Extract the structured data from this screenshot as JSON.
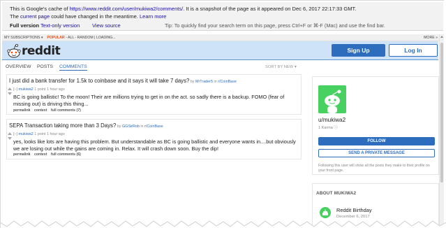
{
  "cache_banner": {
    "line1_prefix": "This is Google's cache of ",
    "line1_url": "https://www.reddit.com/user/mukiwa2/comments/",
    "line1_suffix": ". It is a snapshot of the page as it appeared on Dec 6, 2017 22:17:33 GMT.",
    "line2_prefix": "The ",
    "line2_link": "current page",
    "line2_suffix": " could have changed in the meantime. ",
    "learn_more": "Learn more",
    "full_version": "Full version",
    "text_only": "Text-only version",
    "view_source": "View source",
    "tip": "Tip: To quickly find your search term on this page, press Ctrl+F or ⌘-F (Mac) and use the find bar."
  },
  "subreddit_bar": {
    "my_subscriptions": "MY SUBSCRIPTIONS ▾",
    "popular": "POPULAR",
    "rest": " - ALL - RANDOM  |  LOADING...",
    "more": "MORE »"
  },
  "header": {
    "wordmark": "reddit",
    "signup": "Sign Up",
    "login": "Log In"
  },
  "tabs": {
    "overview": "OVERVIEW",
    "posts": "POSTS",
    "comments": "COMMENTS",
    "sort": "SORT BY NEW ▾"
  },
  "comments": [
    {
      "post_title": "I just did a bank transfer for 1.5k to coinbase and it says it will take 7 days?",
      "by_prefix": " by ",
      "post_author": "MrTrader5",
      "in_prefix": " in ",
      "subreddit": "r/CoinBase",
      "collapse": "[–] ",
      "user": "mukiwa2",
      "meta": " 1 point 1 hour ago",
      "body": "BC is going ballistic! To the moon! Their are millions trying to get in on the act. so sadly there is a backup. FOMO (fear of missing out) is driving this thing...",
      "permalink": "permalink",
      "context": "context",
      "full_comments": "full comments (7)"
    },
    {
      "post_title": "SEPA Transaction taking more than 3 Days?",
      "by_prefix": " by ",
      "post_author": "GGSirRob",
      "in_prefix": " in ",
      "subreddit": "r/CoinBase",
      "collapse": "[–] ",
      "user": "mukiwa2",
      "meta": " 1 point 1 hour ago",
      "body": "yes, looks like lots are having this problem. But understandable as BC is going ballistic and everyone wants in....but obviously we are losing out while the gains are coming in. Relax. It will crash down soon. Buy the dip!",
      "permalink": "permalink",
      "context": "context",
      "full_comments": "full comments (6)"
    }
  ],
  "sidebar": {
    "username": "u/mukiwa2",
    "karma": "1 Karma ⓘ",
    "follow": "FOLLOW",
    "private_message": "SEND A PRIVATE MESSAGE",
    "note": "Following this user will show all the posts they make to their profile on your front page."
  },
  "about": {
    "heading": "ABOUT MUKIWA2",
    "birthday_label": "Reddit Birthday",
    "birthday_date": "December 6, 2017"
  },
  "colors": {
    "reddit_blue": "#2e6dbd",
    "header_bg": "#cee3f8",
    "orange": "#ff4500",
    "snoo_green": "#46d160"
  },
  "icons": {
    "logo": "reddit-snoo-icon",
    "upvote": "upvote-arrow-icon",
    "downvote": "downvote-arrow-icon",
    "cake": "cake-icon"
  }
}
